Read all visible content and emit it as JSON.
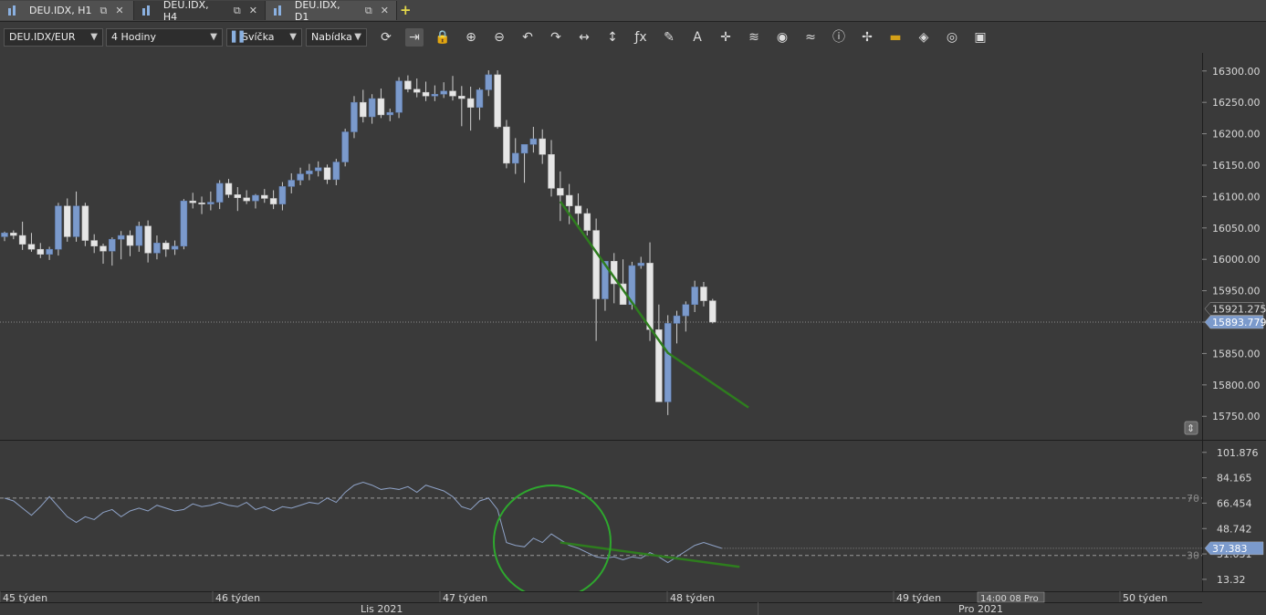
{
  "tabs": [
    {
      "label": "DEU.IDX, H1"
    },
    {
      "label": "DEU.IDX, H4"
    },
    {
      "label": "DEU.IDX, D1"
    }
  ],
  "toolbar": {
    "instrument": "DEU.IDX/EUR",
    "period": "4 Hodiny",
    "chart_style": "Svíčka",
    "price_side": "Nabídka",
    "icons": [
      "refresh-icon",
      "autoscroll-icon",
      "lock-icon",
      "zoom-in-icon",
      "zoom-out-icon",
      "undo-icon",
      "redo-icon",
      "horizontal-resize-icon",
      "vertical-resize-icon",
      "indicator-fx-icon",
      "pencil-icon",
      "text-icon",
      "crosshair-icon",
      "layers-icon",
      "eye-icon",
      "pattern-icon",
      "info-icon",
      "cursor-icon",
      "color-icon",
      "paint-icon",
      "template-icon",
      "save-icon"
    ]
  },
  "colors": {
    "background": "#3a3a3a",
    "bull": "#7b9acc",
    "bear": "#e6e6e6",
    "trend": "#2e7d1e",
    "rsi": "#8fa3c8",
    "circle": "#2ea82e",
    "price_tag": "#7b9acc"
  },
  "chart_data": [
    {
      "type": "candlestick",
      "title": "",
      "ylim": [
        15730,
        16320
      ],
      "yticks": [
        "16300.00",
        "16250.00",
        "16200.00",
        "16150.00",
        "16100.00",
        "16050.00",
        "16000.00",
        "15950.00",
        "15900.00",
        "15850.00",
        "15800.00",
        "15750.00"
      ],
      "grid": false,
      "current_price_label": "15893.779",
      "ask_price_label": "15921.275",
      "candles": [
        [
          16036,
          16044,
          16029,
          16042
        ],
        [
          16042,
          16046,
          16032,
          16038
        ],
        [
          16038,
          16060,
          16015,
          16024
        ],
        [
          16024,
          16042,
          16012,
          16016
        ],
        [
          16016,
          16026,
          16002,
          16008
        ],
        [
          16008,
          16020,
          15999,
          16016
        ],
        [
          16016,
          16090,
          16006,
          16085
        ],
        [
          16085,
          16097,
          16028,
          16036
        ],
        [
          16036,
          16108,
          16028,
          16085
        ],
        [
          16085,
          16090,
          16021,
          16030
        ],
        [
          16030,
          16040,
          16010,
          16021
        ],
        [
          16021,
          16025,
          15993,
          16013
        ],
        [
          16013,
          16035,
          15990,
          16032
        ],
        [
          16032,
          16045,
          16000,
          16038
        ],
        [
          16038,
          16046,
          16005,
          16022
        ],
        [
          16022,
          16060,
          16012,
          16053
        ],
        [
          16053,
          16062,
          15995,
          16010
        ],
        [
          16010,
          16038,
          16000,
          16026
        ],
        [
          16026,
          16030,
          16004,
          16016
        ],
        [
          16016,
          16030,
          16007,
          16021
        ],
        [
          16021,
          16096,
          16016,
          16093
        ],
        [
          16093,
          16106,
          16081,
          16090
        ],
        [
          16090,
          16100,
          16072,
          16088
        ],
        [
          16088,
          16108,
          16078,
          16091
        ],
        [
          16091,
          16126,
          16080,
          16121
        ],
        [
          16121,
          16128,
          16098,
          16103
        ],
        [
          16103,
          16115,
          16077,
          16098
        ],
        [
          16098,
          16110,
          16088,
          16093
        ],
        [
          16093,
          16104,
          16081,
          16102
        ],
        [
          16102,
          16112,
          16090,
          16097
        ],
        [
          16097,
          16110,
          16080,
          16088
        ],
        [
          16088,
          16123,
          16078,
          16116
        ],
        [
          16116,
          16137,
          16105,
          16126
        ],
        [
          16126,
          16146,
          16118,
          16136
        ],
        [
          16136,
          16152,
          16126,
          16141
        ],
        [
          16141,
          16156,
          16132,
          16146
        ],
        [
          16146,
          16151,
          16120,
          16127
        ],
        [
          16127,
          16160,
          16118,
          16155
        ],
        [
          16155,
          16208,
          16148,
          16203
        ],
        [
          16203,
          16260,
          16193,
          16250
        ],
        [
          16250,
          16270,
          16218,
          16227
        ],
        [
          16227,
          16263,
          16216,
          16256
        ],
        [
          16256,
          16272,
          16225,
          16230
        ],
        [
          16230,
          16240,
          16220,
          16234
        ],
        [
          16234,
          16290,
          16225,
          16284
        ],
        [
          16284,
          16293,
          16266,
          16271
        ],
        [
          16271,
          16288,
          16258,
          16266
        ],
        [
          16266,
          16283,
          16252,
          16260
        ],
        [
          16260,
          16277,
          16252,
          16263
        ],
        [
          16263,
          16282,
          16257,
          16268
        ],
        [
          16268,
          16292,
          16253,
          16260
        ],
        [
          16260,
          16276,
          16212,
          16256
        ],
        [
          16256,
          16275,
          16205,
          16242
        ],
        [
          16242,
          16273,
          16222,
          16270
        ],
        [
          16270,
          16301,
          16260,
          16294
        ],
        [
          16294,
          16301,
          16208,
          16211
        ],
        [
          16211,
          16222,
          16145,
          16153
        ],
        [
          16153,
          16193,
          16136,
          16169
        ],
        [
          16169,
          16175,
          16122,
          16183
        ],
        [
          16183,
          16211,
          16170,
          16192
        ],
        [
          16192,
          16207,
          16152,
          16167
        ],
        [
          16167,
          16190,
          16100,
          16113
        ],
        [
          16113,
          16140,
          16061,
          16102
        ],
        [
          16102,
          16120,
          16056,
          16085
        ],
        [
          16085,
          16105,
          16050,
          16073
        ],
        [
          16073,
          16081,
          16038,
          16046
        ],
        [
          16046,
          16065,
          15870,
          15937
        ],
        [
          15937,
          15968,
          15918,
          15997
        ],
        [
          15997,
          16010,
          15930,
          15961
        ],
        [
          15961,
          16000,
          15928,
          15928
        ],
        [
          15928,
          15996,
          15920,
          15990
        ],
        [
          15990,
          16004,
          15985,
          15994
        ],
        [
          15994,
          16027,
          15870,
          15888
        ],
        [
          15888,
          15928,
          15773,
          15773
        ],
        [
          15773,
          15911,
          15752,
          15898
        ],
        [
          15898,
          15918,
          15866,
          15910
        ],
        [
          15910,
          15933,
          15885,
          15928
        ],
        [
          15928,
          15966,
          15916,
          15956
        ],
        [
          15956,
          15964,
          15925,
          15934
        ],
        [
          15934,
          15937,
          15898,
          15900
        ]
      ],
      "trendline": {
        "from": [
          62,
          16092
        ],
        "mid": [
          74,
          15851
        ],
        "to": [
          83,
          15764
        ]
      }
    },
    {
      "type": "line",
      "series": [
        {
          "values": [
            70,
            68,
            63,
            58,
            64,
            71,
            64,
            57,
            53,
            57,
            55,
            60,
            62,
            57,
            61,
            63,
            61,
            65,
            63,
            61,
            62,
            66,
            64,
            65,
            67,
            65,
            64,
            67,
            62,
            64,
            61,
            64,
            63,
            65,
            67,
            66,
            70,
            67,
            74,
            79,
            81,
            79,
            76,
            77,
            76,
            78,
            74,
            79,
            77,
            75,
            71,
            64,
            62,
            68,
            70,
            62,
            39,
            37,
            36,
            42,
            39,
            45,
            41,
            37,
            35,
            32,
            29,
            28,
            29,
            27,
            29,
            28,
            32,
            29,
            25,
            29,
            33,
            37,
            39,
            37,
            35
          ]
        }
      ],
      "ylim": [
        5,
        110
      ],
      "yticks": [
        "101.876",
        "84.165",
        "66.454",
        "48.742",
        "31.031",
        "13.32"
      ],
      "levels": [
        {
          "value": 70,
          "label": "70"
        },
        {
          "value": 30,
          "label": "30"
        }
      ],
      "current_value_label": "37.383",
      "trendline": {
        "from": [
          62,
          39
        ],
        "to": [
          82,
          22
        ]
      }
    }
  ],
  "xaxis": {
    "weeks": [
      {
        "label": "45 týden"
      },
      {
        "label": "46 týden"
      },
      {
        "label": "47 týden"
      },
      {
        "label": "48 týden"
      },
      {
        "label": "49 týden"
      },
      {
        "label": "50 týden"
      }
    ],
    "months": [
      {
        "label": "Lis 2021"
      },
      {
        "label": "Pro 2021"
      }
    ],
    "cursor_label": "14:00 08 Pro"
  }
}
